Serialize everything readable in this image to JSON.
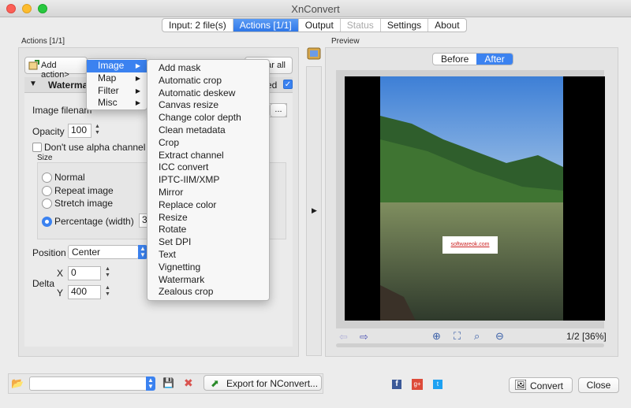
{
  "window": {
    "title": "XnConvert"
  },
  "tabs": [
    {
      "label": "Input: 2 file(s)",
      "state": "normal"
    },
    {
      "label": "Actions [1/1]",
      "state": "active"
    },
    {
      "label": "Output",
      "state": "normal"
    },
    {
      "label": "Status",
      "state": "disabled"
    },
    {
      "label": "Settings",
      "state": "normal"
    },
    {
      "label": "About",
      "state": "normal"
    }
  ],
  "actions_panel": {
    "title": "Actions [1/1]",
    "add_action_label": "Add action>",
    "clear_all_label": "ear all",
    "watermark": {
      "header": "Waterma",
      "enabled_label": "ed",
      "image_filename_label": "Image filenam",
      "browse_label": "...",
      "opacity_label": "Opacity",
      "opacity_value": "100",
      "alpha_label": "Don't use alpha channel",
      "size_label": "Size",
      "size_options": [
        "Normal",
        "Repeat image",
        "Stretch image",
        "Percentage (width)"
      ],
      "size_selected": 3,
      "percentage_value": "3",
      "position_label": "Position",
      "position_value": "Center",
      "delta_label": "Delta",
      "x_label": "X",
      "x_value": "0",
      "y_label": "Y",
      "y_value": "400"
    }
  },
  "category_menu": {
    "items": [
      "Image",
      "Map",
      "Filter",
      "Misc"
    ],
    "highlighted": 0,
    "submenu_arrow": "▶"
  },
  "image_submenu": {
    "items": [
      "Add mask",
      "Automatic crop",
      "Automatic deskew",
      "Canvas resize",
      "Change color depth",
      "Clean metadata",
      "Crop",
      "Extract channel",
      "ICC convert",
      "IPTC-IIM/XMP",
      "Mirror",
      "Replace color",
      "Resize",
      "Rotate",
      "Set DPI",
      "Text",
      "Vignetting",
      "Watermark",
      "Zealous crop"
    ]
  },
  "preview": {
    "title": "Preview",
    "before_label": "Before",
    "after_label": "After",
    "watermark_text": "softwareok.com",
    "page_info": "1/2 [36%]"
  },
  "bottom": {
    "export_label": "Export for NConvert...",
    "convert_label": "Convert",
    "close_label": "Close",
    "preset_value": ""
  },
  "colors": {
    "accent": "#3b82f0",
    "facebook": "#3b5998",
    "googleplus": "#dd4b39",
    "twitter": "#1da1f2"
  }
}
